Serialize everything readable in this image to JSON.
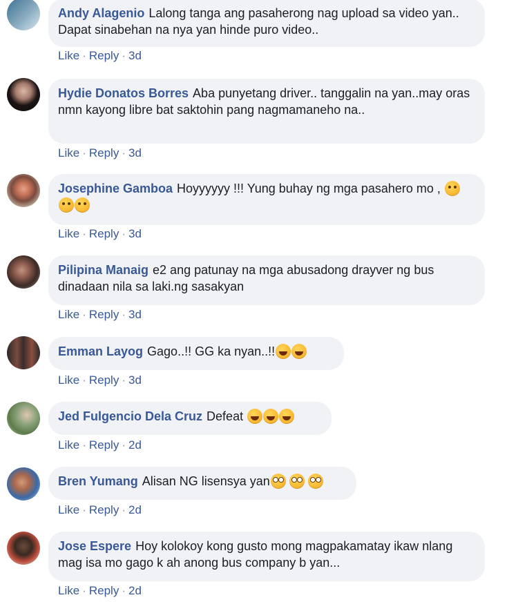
{
  "actions": {
    "like": "Like",
    "reply": "Reply",
    "separator": "·"
  },
  "comments": [
    {
      "author": "Andy Alagenio",
      "text": "Lalong tanga ang pasaherong nag upload sa video yan.. Dapat sinabehan na nya yan hinde puro video..",
      "time": "3d",
      "avatar_icon": "profile-photo"
    },
    {
      "author": "Hydie Donatos Borres",
      "text": "Aba punyetang driver.. tanggalin na yan..may oras nmn kayong libre bat saktohin pang nagmamaneho na..",
      "time": "3d",
      "avatar_icon": "profile-photo"
    },
    {
      "author": "Josephine Gamboa",
      "text": "Hoyyyyyy !!! Yung buhay ng mga pasahero mo , ",
      "time": "3d",
      "emojis": [
        "angry-face",
        "angry-face",
        "angry-face"
      ],
      "avatar_icon": "profile-photo"
    },
    {
      "author": "Pilipina Manaig",
      "text": "e2 ang patunay na mga abusadong drayver ng bus dinadaan nila sa laki.ng sasakyan",
      "time": "3d",
      "avatar_icon": "profile-photo"
    },
    {
      "author": "Emman Layog",
      "text": "Gago..!! GG ka nyan..!!",
      "time": "3d",
      "emojis": [
        "rofl-face",
        "rofl-face"
      ],
      "avatar_icon": "profile-photo"
    },
    {
      "author": "Jed Fulgencio Dela Cruz",
      "text": "Defeat ",
      "time": "2d",
      "emojis": [
        "tears-of-joy-face",
        "tears-of-joy-face",
        "tears-of-joy-face"
      ],
      "avatar_icon": "profile-photo"
    },
    {
      "author": "Bren Yumang",
      "text": "Alisan NG lisensya yan",
      "time": "2d",
      "emojis": [
        "flushed-face",
        "flushed-face",
        "flushed-face"
      ],
      "avatar_icon": "profile-photo"
    },
    {
      "author": "Jose Espere",
      "text": "Hoy kolokoy kong gusto mong magpakamatay ikaw nlang mag isa mo gago k ah anong bus company b yan...",
      "time": "2d",
      "avatar_icon": "profile-photo"
    }
  ],
  "colors": {
    "author": "#385898",
    "bubble": "#f0f2f5",
    "action": "#385898"
  }
}
